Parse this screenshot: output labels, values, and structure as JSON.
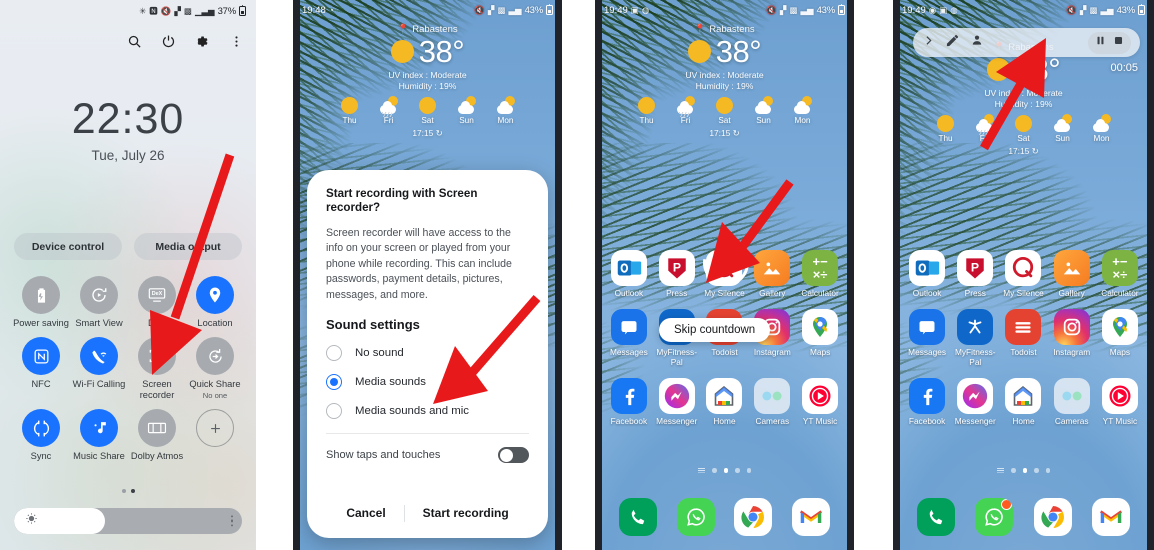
{
  "panels": [
    {
      "id": "quick-settings",
      "statusbar": {
        "icons": [
          "bluetooth-icon",
          "nfc-icon",
          "mute-icon",
          "wifi-icon",
          "vpn-icon",
          "signal-icon"
        ],
        "battery": "37%"
      },
      "header_icons": [
        "search-icon",
        "power-icon",
        "settings-icon",
        "more-options-icon"
      ],
      "clock": {
        "time": "22:30",
        "date": "Tue, July 26"
      },
      "pills": [
        "Device control",
        "Media output"
      ],
      "tiles": [
        {
          "label": "Power saving",
          "icon": "power-saving-icon",
          "state": "off"
        },
        {
          "label": "Smart View",
          "icon": "smart-view-icon",
          "state": "off"
        },
        {
          "label": "DeX",
          "icon": "dex-icon",
          "state": "off"
        },
        {
          "label": "Location",
          "icon": "location-icon",
          "state": "on"
        },
        {
          "label": "NFC",
          "icon": "nfc-icon",
          "state": "on"
        },
        {
          "label": "Wi-Fi Calling",
          "icon": "wifi-calling-icon",
          "state": "on"
        },
        {
          "label": "Screen recorder",
          "icon": "screen-recorder-icon",
          "state": "off"
        },
        {
          "label": "Quick Share",
          "sub": "No one",
          "icon": "quick-share-icon",
          "state": "off"
        },
        {
          "label": "Sync",
          "icon": "sync-icon",
          "state": "on"
        },
        {
          "label": "Music Share",
          "icon": "music-share-icon",
          "state": "on"
        },
        {
          "label": "Dolby Atmos",
          "icon": "dolby-atmos-icon",
          "state": "off"
        },
        {
          "label": "",
          "icon": "add-tile-icon",
          "state": "plus"
        }
      ],
      "brightness": {
        "value_percent": 40,
        "icon": "brightness-icon",
        "menu": "more-options-icon"
      },
      "page_dots": {
        "count": 2,
        "active": 1
      }
    },
    {
      "id": "recorder-dialog",
      "statusbar": {
        "time": "19:48",
        "icons": [
          "alarm-icon",
          "mute-icon",
          "wifi-icon",
          "vpn-icon",
          "signal-icon"
        ],
        "battery": "43%"
      },
      "weather": {
        "city": "Rabastens",
        "temperature": "38°",
        "uv": "UV index : Moderate",
        "humidity": "Humidity : 19%",
        "days": [
          {
            "label": "Thu",
            "icon": "sunny-icon"
          },
          {
            "label": "Fri",
            "icon": "rain-icon"
          },
          {
            "label": "Sat",
            "icon": "sunny-icon"
          },
          {
            "label": "Sun",
            "icon": "partly-cloudy-icon"
          },
          {
            "label": "Mon",
            "icon": "partly-cloudy-icon"
          }
        ],
        "updated": "17:15"
      },
      "dialog": {
        "title": "Start recording with Screen recorder?",
        "body": "Screen recorder will have access to the info on your screen or played from your phone while recording. This can include passwords, payment details, pictures, messages, and more.",
        "section": "Sound settings",
        "options": [
          {
            "label": "No sound",
            "selected": false
          },
          {
            "label": "Media sounds",
            "selected": true
          },
          {
            "label": "Media sounds and mic",
            "selected": false
          }
        ],
        "toggle": {
          "label": "Show taps and touches",
          "on": false
        },
        "cancel": "Cancel",
        "confirm": "Start recording"
      }
    },
    {
      "id": "countdown-home",
      "statusbar": {
        "time": "19:49",
        "icons": [
          "gallery-icon",
          "whatsapp-icon",
          "mute-icon",
          "wifi-icon",
          "vpn-icon",
          "signal-icon"
        ],
        "battery": "43%"
      },
      "weather": {
        "city": "Rabastens",
        "temperature": "38°",
        "uv": "UV index : Moderate",
        "humidity": "Humidity : 19%",
        "days": [
          {
            "label": "Thu",
            "icon": "sunny-icon"
          },
          {
            "label": "Fri",
            "icon": "rain-icon"
          },
          {
            "label": "Sat",
            "icon": "sunny-icon"
          },
          {
            "label": "Sun",
            "icon": "partly-cloudy-icon"
          },
          {
            "label": "Mon",
            "icon": "partly-cloudy-icon"
          }
        ],
        "updated": "17:15"
      },
      "skip_countdown": "Skip countdown",
      "page_dots": {
        "count": 4,
        "active": 1
      }
    },
    {
      "id": "recording-active",
      "statusbar": {
        "time": "19:49",
        "icons": [
          "recording-icon",
          "alarm-icon",
          "gallery-icon",
          "whatsapp-icon",
          "mute-icon",
          "wifi-icon",
          "vpn-icon",
          "signal-icon"
        ],
        "battery": "43%"
      },
      "weather": {
        "city": "Rabastens",
        "temperature": "38°",
        "uv": "UV index : Moderate",
        "humidity": "Humidity : 19%",
        "days": [
          {
            "label": "Thu",
            "icon": "sunny-icon"
          },
          {
            "label": "Fri",
            "icon": "rain-icon"
          },
          {
            "label": "Sat",
            "icon": "sunny-icon"
          },
          {
            "label": "Sun",
            "icon": "partly-cloudy-icon"
          },
          {
            "label": "Mon",
            "icon": "partly-cloudy-icon"
          }
        ],
        "updated": "17:15"
      },
      "recorder_toolbar": {
        "expand": "chevron-right-icon",
        "draw": "pencil-icon",
        "selfie": "person-icon",
        "pause": "pause-icon",
        "stop": "stop-icon",
        "timer": "00:05"
      },
      "page_dots": {
        "count": 4,
        "active": 1
      }
    }
  ],
  "home_apps": {
    "rows": [
      [
        {
          "name": "Outlook",
          "icon": "outlook-icon"
        },
        {
          "name": "Press",
          "icon": "press-icon"
        },
        {
          "name": "My Silence",
          "icon": "my-silence-icon"
        },
        {
          "name": "Gallery",
          "icon": "gallery-icon"
        },
        {
          "name": "Calculator",
          "icon": "calculator-icon"
        }
      ],
      [
        {
          "name": "Messages",
          "icon": "messages-icon"
        },
        {
          "name": "MyFitness-Pal",
          "icon": "myfitnesspal-icon"
        },
        {
          "name": "Todoist",
          "icon": "todoist-icon"
        },
        {
          "name": "Instagram",
          "icon": "instagram-icon"
        },
        {
          "name": "Maps",
          "icon": "maps-icon"
        }
      ],
      [
        {
          "name": "Facebook",
          "icon": "facebook-icon"
        },
        {
          "name": "Messenger",
          "icon": "messenger-icon"
        },
        {
          "name": "Home",
          "icon": "google-home-icon"
        },
        {
          "name": "Cameras",
          "icon": "cameras-folder-icon"
        },
        {
          "name": "YT Music",
          "icon": "youtube-music-icon"
        }
      ]
    ],
    "dock": [
      {
        "name": "Phone",
        "icon": "phone-icon"
      },
      {
        "name": "WhatsApp",
        "icon": "whatsapp-icon"
      },
      {
        "name": "Chrome",
        "icon": "chrome-icon"
      },
      {
        "name": "Gmail",
        "icon": "gmail-icon"
      }
    ]
  },
  "annotations": {
    "arrow_color": "#e8191b",
    "arrows": [
      {
        "target": "screen-recorder-tile"
      },
      {
        "target": "media-sounds-option"
      },
      {
        "target": "skip-countdown-area"
      },
      {
        "target": "pencil-tool"
      }
    ]
  },
  "colors": {
    "accent_blue": "#1a73ff",
    "tile_off": "#a7abb0",
    "arrow_red": "#e8191b",
    "sun_yellow": "#f5b924"
  }
}
